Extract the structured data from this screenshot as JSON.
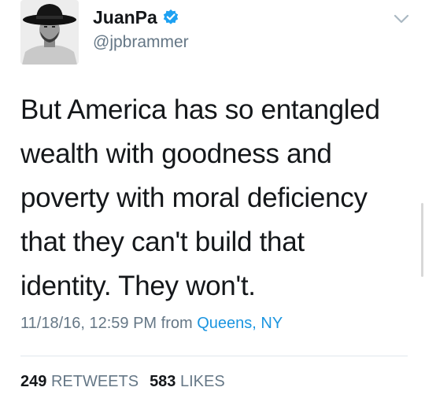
{
  "user": {
    "name": "JuanPa",
    "handle": "@jpbrammer",
    "verified": true
  },
  "tweet": {
    "lines": [
      "But America has so entangled",
      "wealth with goodness and",
      "poverty with moral deficiency",
      "that they can't build that",
      "identity. They won't."
    ]
  },
  "meta": {
    "timestamp": "11/18/16, 12:59 PM",
    "from_label": "from",
    "location": "Queens, NY"
  },
  "stats": {
    "retweets_count": "249",
    "retweets_label": "RETWEETS",
    "likes_count": "583",
    "likes_label": "LIKES"
  },
  "icons": {
    "verified": "verified-badge-icon",
    "menu": "chevron-down-icon"
  },
  "colors": {
    "link": "#1b95e0",
    "verified": "#1da1f2",
    "secondary_text": "#657786",
    "primary_text": "#14171a"
  }
}
